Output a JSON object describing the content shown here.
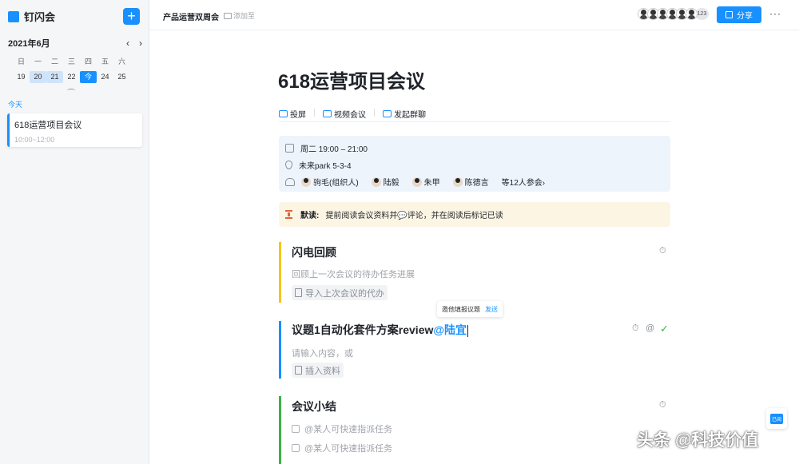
{
  "app": {
    "name": "钉闪会",
    "add_label": "+"
  },
  "calendar": {
    "month": "2021年6月",
    "prev": "‹",
    "next": "›",
    "weekdays": [
      "日",
      "一",
      "二",
      "三",
      "四",
      "五",
      "六"
    ],
    "days": [
      "19",
      "20",
      "21",
      "22",
      "今",
      "24",
      "25"
    ],
    "today_label": "今天"
  },
  "sidebar_meeting": {
    "title": "618运营项目会议",
    "time": "10:00~12:00"
  },
  "topbar": {
    "doc_title": "产品运营双周会",
    "add_to": "添加至",
    "member_count": "123",
    "share_label": "分享",
    "more": "···"
  },
  "meeting": {
    "title": "618运营项目会议",
    "actions": [
      "投屏",
      "视频会议",
      "发起群聊"
    ],
    "time": "周二 19:00 – 21:00",
    "location": "未来park 5-3-4",
    "attendees": [
      "驹毛(组织人)",
      "陆毅",
      "朱甲",
      "陈德言"
    ],
    "attendee_more": "等12人参会",
    "notice_strong": "默读:",
    "notice_text": "提前阅读会议资料并💬评论，并在阅读后标记已读"
  },
  "agenda": [
    {
      "title": "闪电回顾",
      "desc": "回顾上一次会议的待办任务进展",
      "chip": "导入上次会议的代办",
      "color": "#f5c518"
    },
    {
      "title": "议题1自动化套件方案review",
      "mention": "@陆宜",
      "desc": "请输入内容，或",
      "chip": "插入资料",
      "color": "#1890ff"
    },
    {
      "title": "会议小结",
      "todos": [
        "@某人可快速指派任务",
        "@某人可快速指派任务"
      ],
      "color": "#3bb346"
    }
  ],
  "invite_popup": {
    "text": "邀他填报议题",
    "send": "发送"
  },
  "icons": {
    "timer": "⏱",
    "at": "@",
    "check": "✓"
  },
  "read_badge": "已阅",
  "watermark": "头条 @科技价值"
}
